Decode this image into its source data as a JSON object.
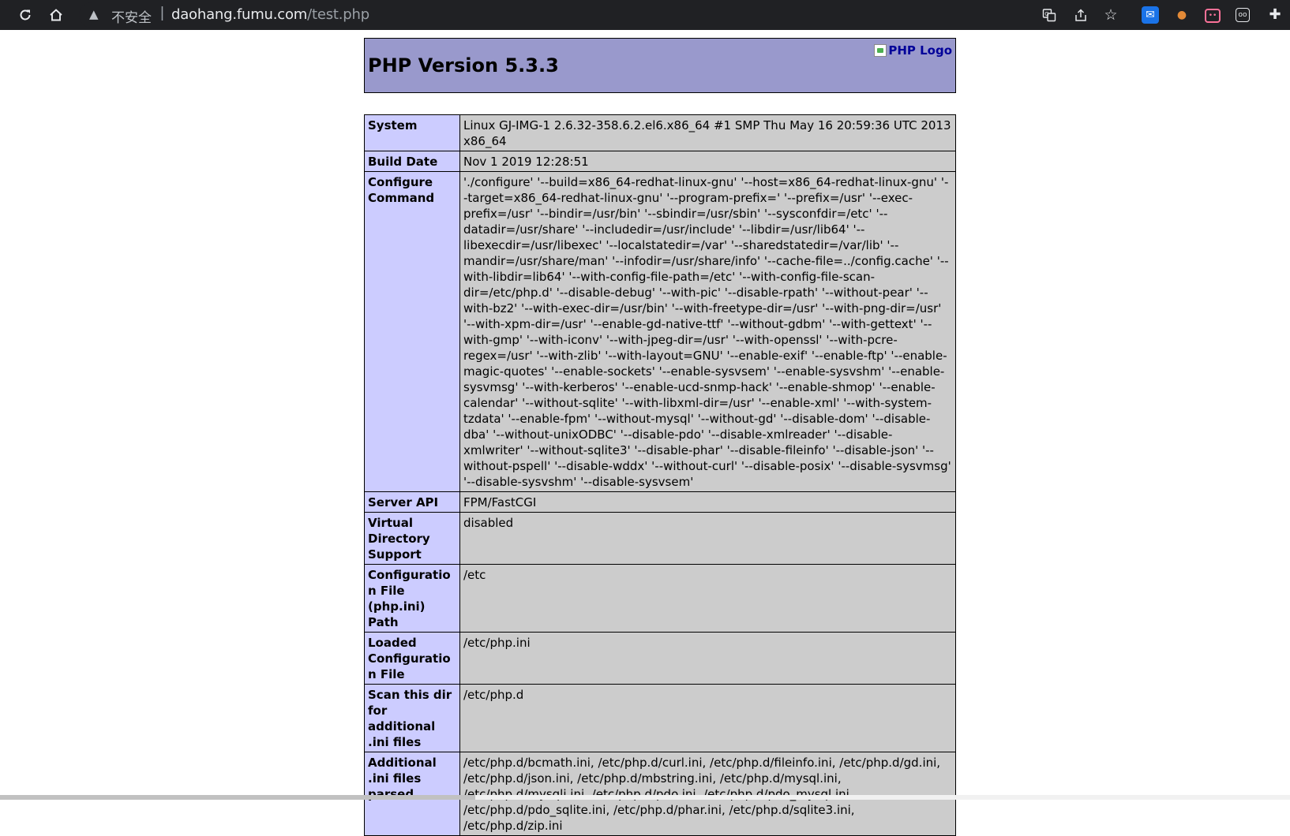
{
  "browser": {
    "nav": {
      "reload_icon": "reload-icon",
      "home_icon": "home-icon"
    },
    "omnibox": {
      "security_label": "不安全",
      "url_host": "daohang.fumu.com",
      "url_path": "/test.php"
    },
    "actions": [
      "translate-icon",
      "share-icon",
      "bookmark-star-icon"
    ],
    "extensions": [
      "extension-blue-icon",
      "extension-monkey-icon",
      "extension-bilibili-icon",
      "extension-glasses-icon",
      "puzzle-extensions-icon"
    ]
  },
  "page": {
    "title": "PHP Version 5.3.3",
    "logo_alt": "PHP Logo",
    "rows": [
      {
        "label": "System",
        "value": "Linux GJ-IMG-1 2.6.32-358.6.2.el6.x86_64 #1 SMP Thu May 16 20:59:36 UTC 2013 x86_64"
      },
      {
        "label": "Build Date",
        "value": "Nov 1 2019 12:28:51"
      },
      {
        "label": "Configure Command",
        "value": "'./configure' '--build=x86_64-redhat-linux-gnu' '--host=x86_64-redhat-linux-gnu' '--target=x86_64-redhat-linux-gnu' '--program-prefix=' '--prefix=/usr' '--exec-prefix=/usr' '--bindir=/usr/bin' '--sbindir=/usr/sbin' '--sysconfdir=/etc' '--datadir=/usr/share' '--includedir=/usr/include' '--libdir=/usr/lib64' '--libexecdir=/usr/libexec' '--localstatedir=/var' '--sharedstatedir=/var/lib' '--mandir=/usr/share/man' '--infodir=/usr/share/info' '--cache-file=../config.cache' '--with-libdir=lib64' '--with-config-file-path=/etc' '--with-config-file-scan-dir=/etc/php.d' '--disable-debug' '--with-pic' '--disable-rpath' '--without-pear' '--with-bz2' '--with-exec-dir=/usr/bin' '--with-freetype-dir=/usr' '--with-png-dir=/usr' '--with-xpm-dir=/usr' '--enable-gd-native-ttf' '--without-gdbm' '--with-gettext' '--with-gmp' '--with-iconv' '--with-jpeg-dir=/usr' '--with-openssl' '--with-pcre-regex=/usr' '--with-zlib' '--with-layout=GNU' '--enable-exif' '--enable-ftp' '--enable-magic-quotes' '--enable-sockets' '--enable-sysvsem' '--enable-sysvshm' '--enable-sysvmsg' '--with-kerberos' '--enable-ucd-snmp-hack' '--enable-shmop' '--enable-calendar' '--without-sqlite' '--with-libxml-dir=/usr' '--enable-xml' '--with-system-tzdata' '--enable-fpm' '--without-mysql' '--without-gd' '--disable-dom' '--disable-dba' '--without-unixODBC' '--disable-pdo' '--disable-xmlreader' '--disable-xmlwriter' '--without-sqlite3' '--disable-phar' '--disable-fileinfo' '--disable-json' '--without-pspell' '--disable-wddx' '--without-curl' '--disable-posix' '--disable-sysvmsg' '--disable-sysvshm' '--disable-sysvsem'"
      },
      {
        "label": "Server API",
        "value": "FPM/FastCGI"
      },
      {
        "label": "Virtual Directory Support",
        "value": "disabled"
      },
      {
        "label": "Configuration File (php.ini) Path",
        "value": "/etc"
      },
      {
        "label": "Loaded Configuration File",
        "value": "/etc/php.ini"
      },
      {
        "label": "Scan this dir for additional .ini files",
        "value": "/etc/php.d"
      },
      {
        "label": "Additional .ini files parsed",
        "value": "/etc/php.d/bcmath.ini, /etc/php.d/curl.ini, /etc/php.d/fileinfo.ini, /etc/php.d/gd.ini, /etc/php.d/json.ini, /etc/php.d/mbstring.ini, /etc/php.d/mysql.ini, /etc/php.d/mysqli.ini, /etc/php.d/pdo.ini, /etc/php.d/pdo_mysql.ini, /etc/php.d/pdo_sqlite.ini, /etc/php.d/phar.ini, /etc/php.d/sqlite3.ini, /etc/php.d/zip.ini"
      }
    ]
  }
}
